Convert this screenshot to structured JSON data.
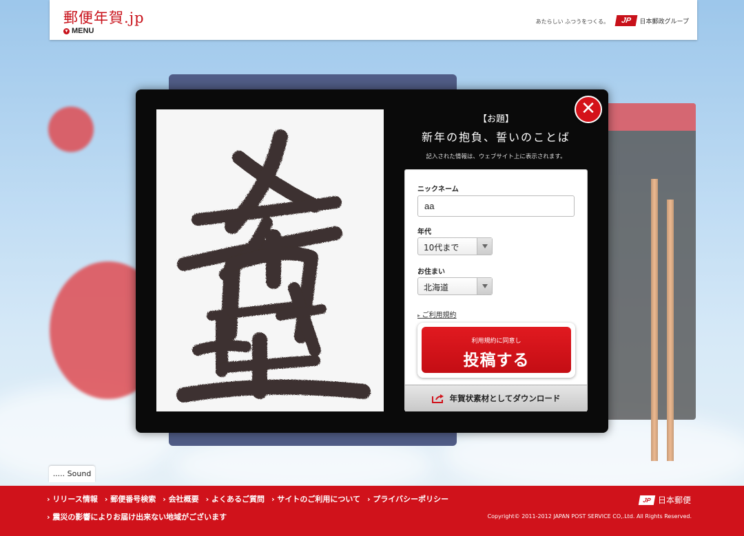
{
  "header": {
    "logo": "郵便年賀.jp",
    "menu_label": "MENU",
    "tagline": "あたらしい ふつうをつくる。",
    "group_mark": "JP",
    "group_name": "日本郵政グループ"
  },
  "modal": {
    "close_symbol": "✕",
    "topic_label": "【お題】",
    "topic": "新年の抱負、誓いのことば",
    "notice": "記入された情報は、ウェブサイト上に表示されます。",
    "calligraphy": "希望",
    "form": {
      "nickname_label": "ニックネーム",
      "nickname_value": "aa",
      "age_label": "年代",
      "age_value": "10代まで",
      "residence_label": "お住まい",
      "residence_value": "北海道",
      "terms_link": "ご利用規約",
      "post_sub": "利用規約に同意し",
      "post_main": "投稿する",
      "download_label": "年賀状素材としてダウンロード"
    }
  },
  "sound_label": "..... Sound",
  "footer": {
    "links": [
      "リリース情報",
      "郵便番号検索",
      "会社概要",
      "よくあるご質問",
      "サイトのご利用について",
      "プライバシーポリシー"
    ],
    "notice": "震災の影響によりお届け出来ない地域がございます",
    "brand_mark": "JP",
    "brand": "日本郵便",
    "copyright": "Copyright© 2011-2012 JAPAN POST SERVICE CO,.Ltd. All Rights Reserved."
  },
  "colors": {
    "brand_red": "#d0121b",
    "modal_bg": "#0a0a0a",
    "ink": "#2a1e1a"
  }
}
